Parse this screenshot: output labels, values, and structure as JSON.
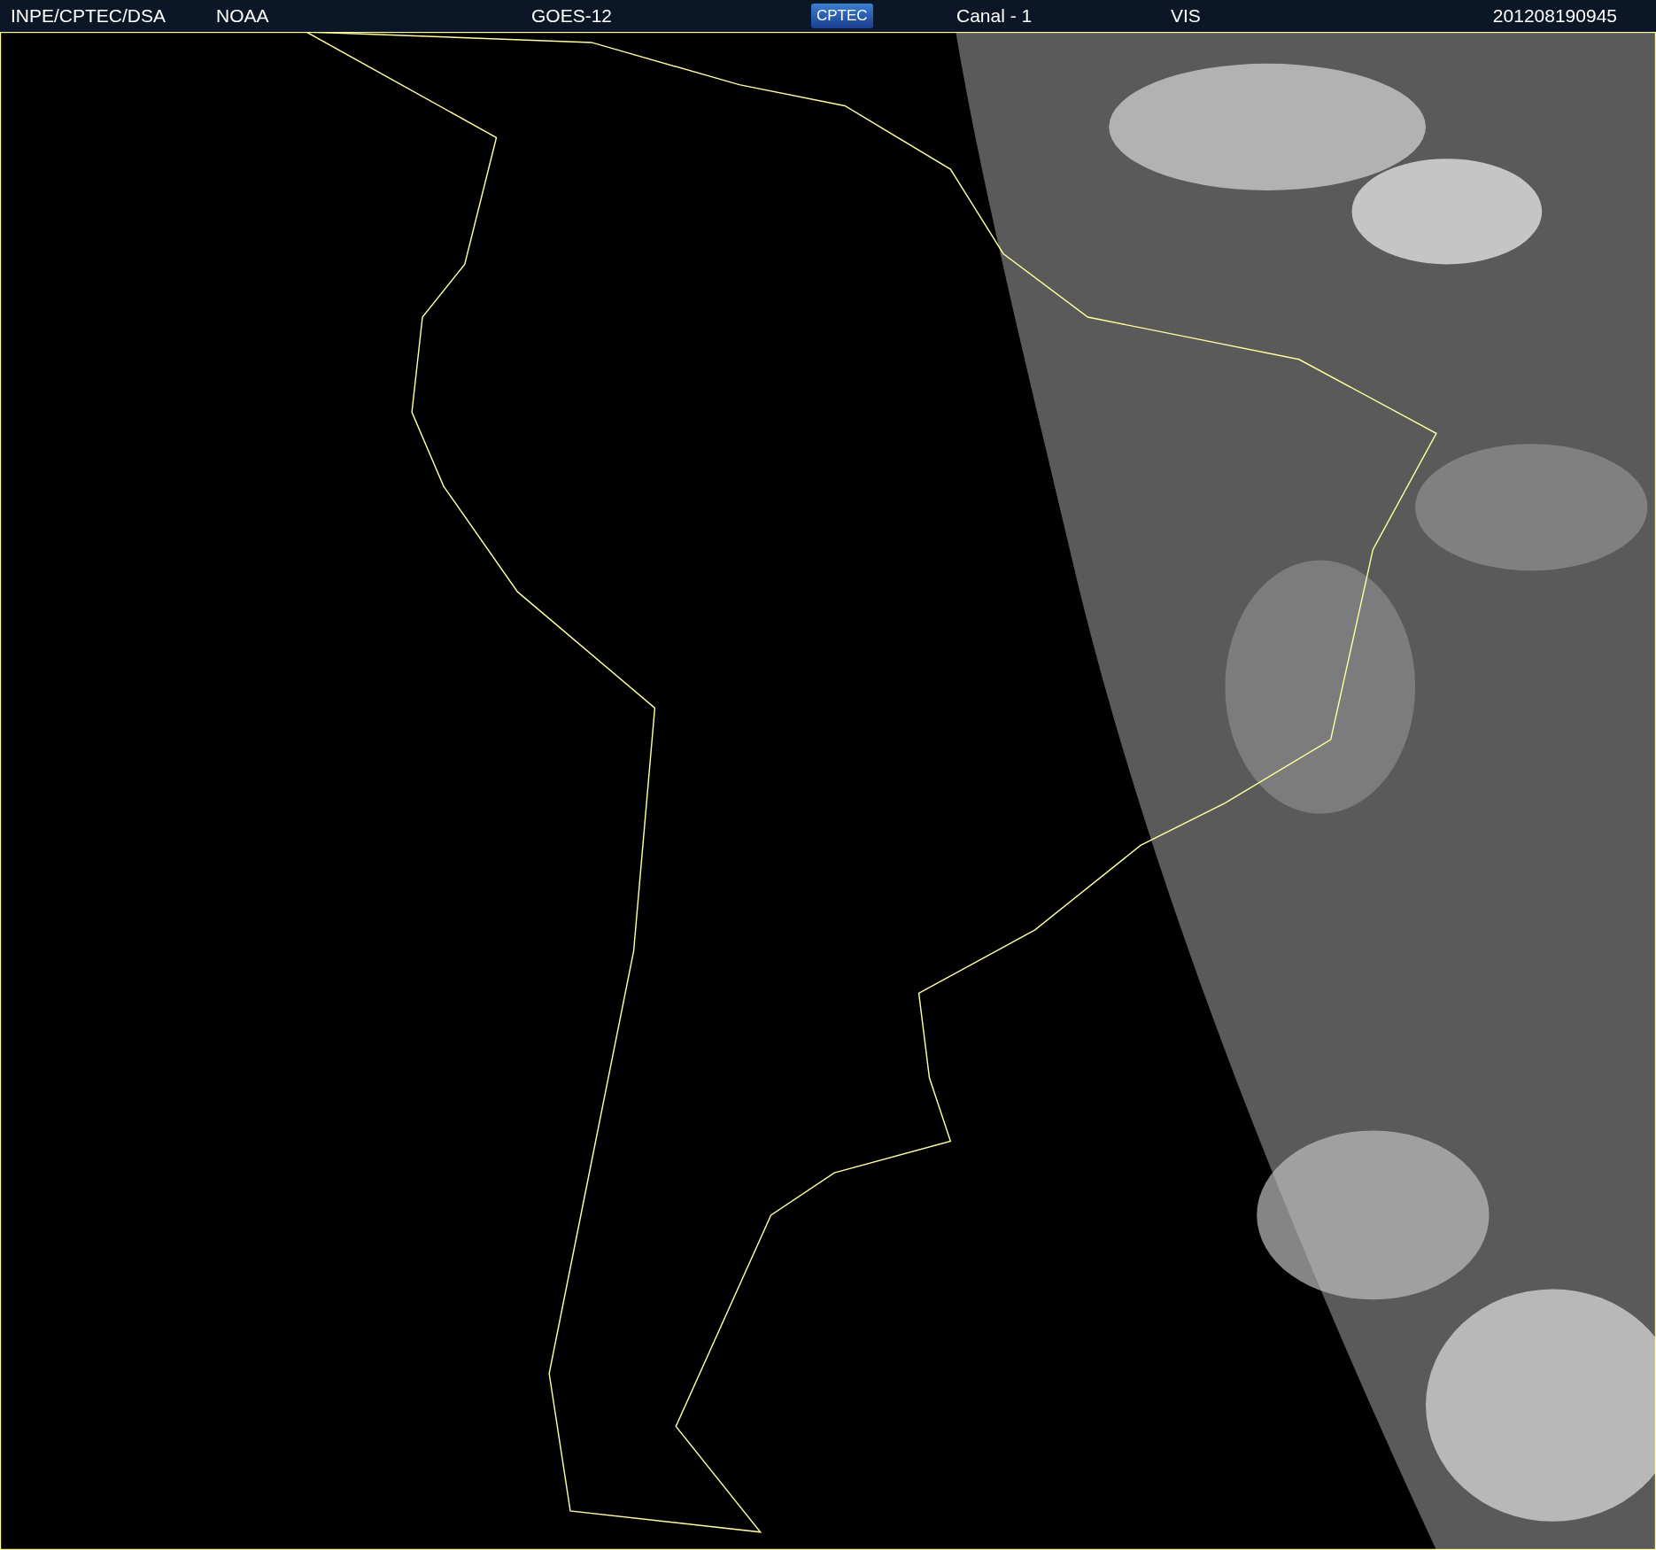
{
  "header": {
    "source": "INPE/CPTEC/DSA",
    "agency": "NOAA",
    "satellite": "GOES-12",
    "logo": "CPTEC",
    "channel": "Canal - 1",
    "band": "VIS",
    "timestamp": "201208190945"
  }
}
